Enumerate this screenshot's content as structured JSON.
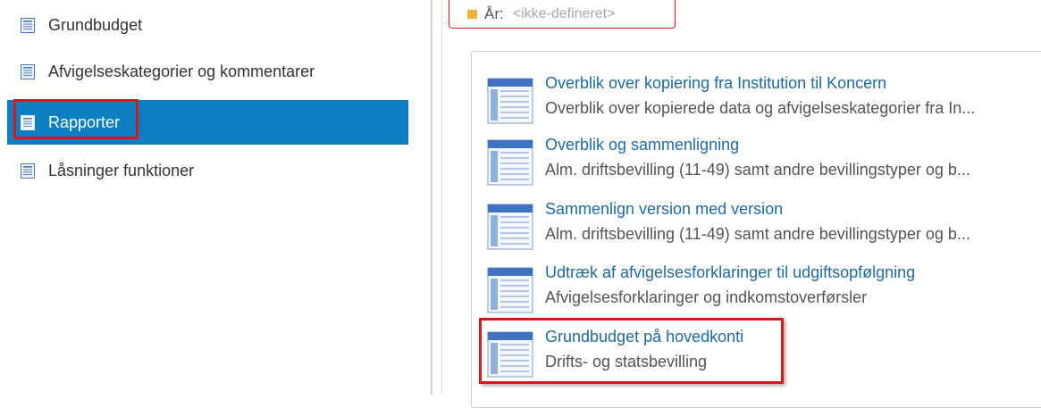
{
  "nav": {
    "items": [
      {
        "label": "Grundbudget",
        "icon": "document-icon"
      },
      {
        "label": "Afvigelseskategorier og kommentarer",
        "icon": "document-icon"
      },
      {
        "label": "Rapporter",
        "icon": "document-icon",
        "active": true
      },
      {
        "label": "Låsninger funktioner",
        "icon": "document-icon"
      }
    ],
    "active_color": "#0b7fc1"
  },
  "year_field": {
    "label": "År:",
    "value": "<ikke-defineret>"
  },
  "reports": [
    {
      "title": "Overblik over kopiering fra Institution til Koncern",
      "description": "Overblik over kopierede data og afvigelseskategorier fra In..."
    },
    {
      "title": "Overblik og sammenligning",
      "description": "Alm. driftsbevilling (11-49) samt andre bevillingstyper og b..."
    },
    {
      "title": "Sammenlign version med version",
      "description": "Alm. driftsbevilling (11-49) samt andre bevillingstyper og b..."
    },
    {
      "title": "Udtræk af afvigelsesforklaringer til udgiftsopfølgning",
      "description": "Afvigelsesforklaringer og indkomstoverførsler"
    },
    {
      "title": "Grundbudget på hovedkonti",
      "description": "Drifts- og statsbevilling"
    }
  ],
  "colors": {
    "link": "#1f6aa5",
    "highlight": "#e0151b"
  }
}
